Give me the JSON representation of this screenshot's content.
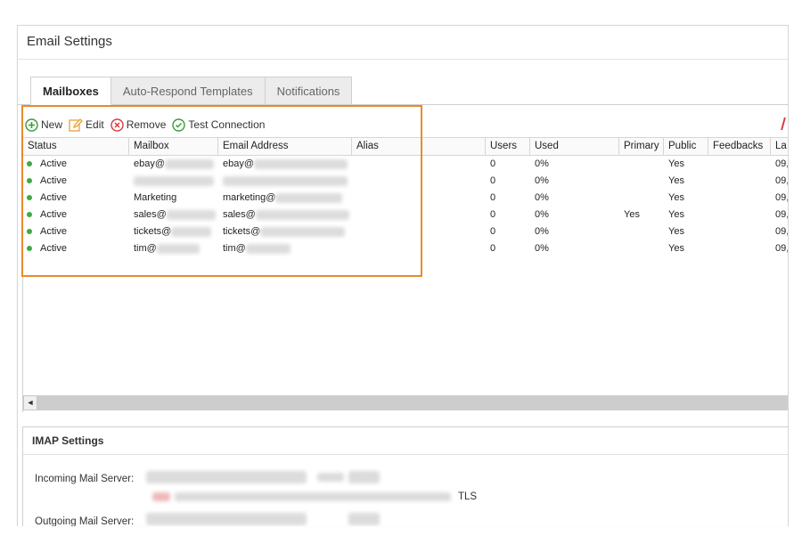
{
  "panel": {
    "title": "Email Settings"
  },
  "tabs": [
    {
      "label": "Mailboxes",
      "active": true
    },
    {
      "label": "Auto-Respond Templates",
      "active": false
    },
    {
      "label": "Notifications",
      "active": false
    }
  ],
  "toolbar": {
    "new_label": "New",
    "edit_label": "Edit",
    "remove_label": "Remove",
    "test_label": "Test Connection"
  },
  "grid": {
    "columns": [
      "Status",
      "Mailbox",
      "Email Address",
      "Alias",
      "Users",
      "Used",
      "Primary",
      "Public",
      "Feedbacks",
      "La"
    ],
    "rows": [
      {
        "status": "Active",
        "mailbox": "ebay@",
        "email": "ebay@",
        "alias": "",
        "users": "0",
        "used": "0%",
        "primary": "",
        "public": "Yes",
        "feedbacks": "",
        "last": "09,"
      },
      {
        "status": "Active",
        "mailbox": "",
        "email": "",
        "alias": "",
        "users": "0",
        "used": "0%",
        "primary": "",
        "public": "Yes",
        "feedbacks": "",
        "last": "09,"
      },
      {
        "status": "Active",
        "mailbox": "Marketing",
        "email": "marketing@",
        "alias": "",
        "users": "0",
        "used": "0%",
        "primary": "",
        "public": "Yes",
        "feedbacks": "",
        "last": "09,"
      },
      {
        "status": "Active",
        "mailbox": "sales@",
        "email": "sales@",
        "alias": "",
        "users": "0",
        "used": "0%",
        "primary": "Yes",
        "public": "Yes",
        "feedbacks": "",
        "last": "09,"
      },
      {
        "status": "Active",
        "mailbox": "tickets@",
        "email": "tickets@",
        "alias": "",
        "users": "0",
        "used": "0%",
        "primary": "",
        "public": "Yes",
        "feedbacks": "",
        "last": "09,"
      },
      {
        "status": "Active",
        "mailbox": "tim@",
        "email": "tim@",
        "alias": "",
        "users": "0",
        "used": "0%",
        "primary": "",
        "public": "Yes",
        "feedbacks": "",
        "last": "09,"
      }
    ]
  },
  "scrollbar": {
    "left_arrow": "◄"
  },
  "imap": {
    "title": "IMAP Settings",
    "incoming_label": "Incoming Mail Server:",
    "tls_label": "TLS",
    "outgoing_label": "Outgoing Mail Server:"
  },
  "colors": {
    "status_active": "#3faa3f",
    "highlight": "#e88a2e",
    "new_icon": "#3a9b3a",
    "edit_icon": "#e8a23a",
    "remove_icon": "#d93b3b"
  },
  "icons": {
    "new": "plus-circle-icon",
    "edit": "pencil-icon",
    "remove": "x-circle-icon",
    "test": "check-circle-icon"
  }
}
